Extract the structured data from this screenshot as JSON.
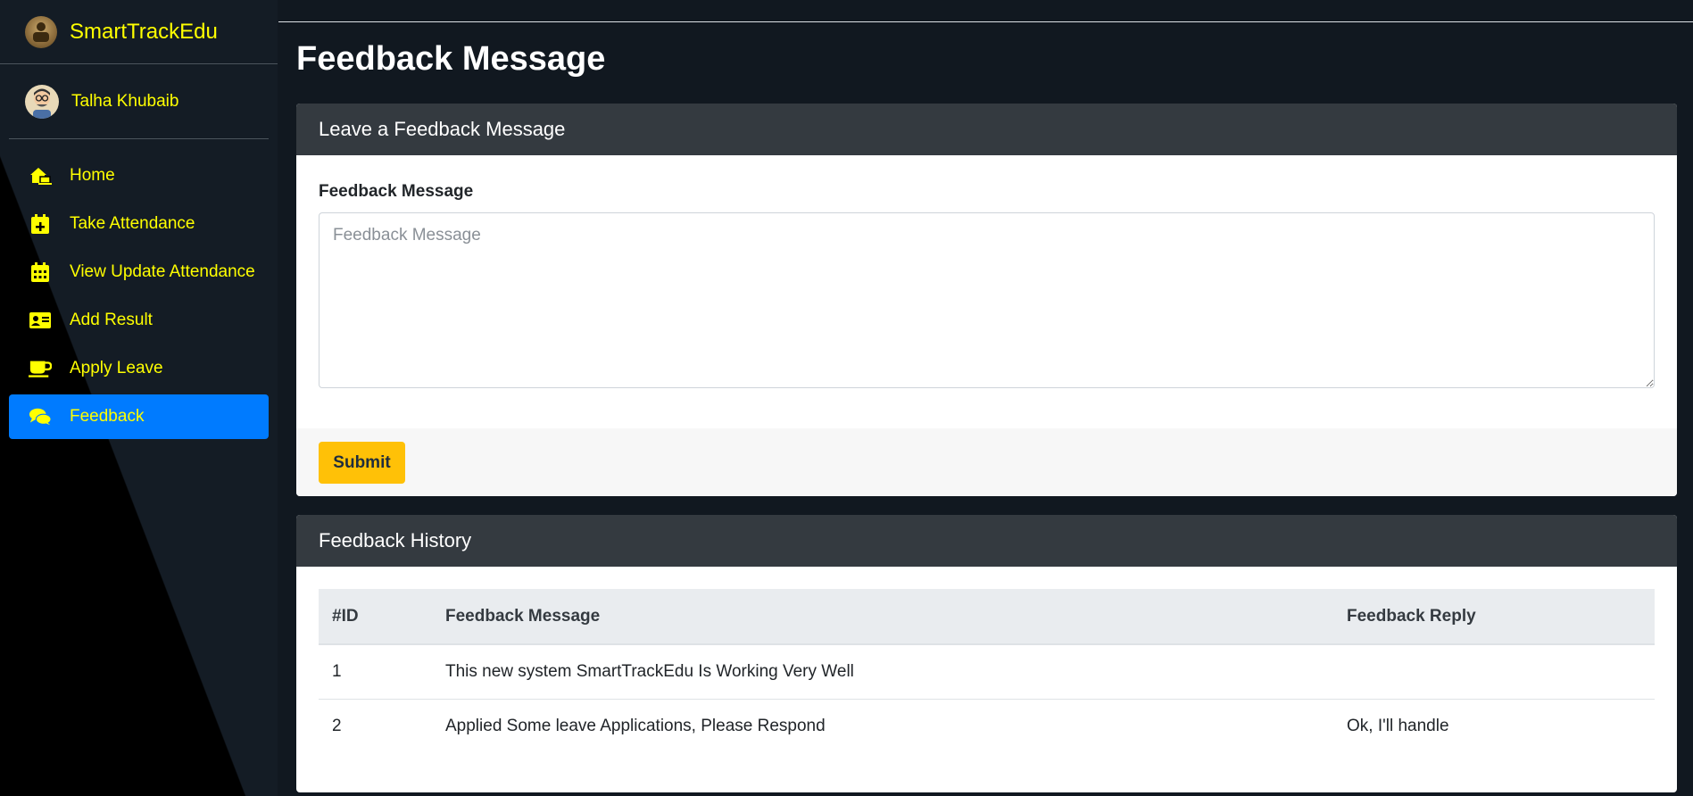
{
  "sidebar": {
    "brand": "SmartTrackEdu",
    "user_name": "Talha Khubaib",
    "items": [
      {
        "label": "Home",
        "icon": "home-laptop-icon",
        "active": false
      },
      {
        "label": "Take Attendance",
        "icon": "calendar-plus-icon",
        "active": false
      },
      {
        "label": "View Update Attendance",
        "icon": "calendar-grid-icon",
        "active": false
      },
      {
        "label": "Add Result",
        "icon": "id-card-icon",
        "active": false
      },
      {
        "label": "Apply Leave",
        "icon": "coffee-cup-icon",
        "active": false
      },
      {
        "label": "Feedback",
        "icon": "comments-icon",
        "active": true
      }
    ]
  },
  "page": {
    "title": "Feedback Message"
  },
  "form_card": {
    "header": "Leave a Feedback Message",
    "field_label": "Feedback Message",
    "field_placeholder": "Feedback Message",
    "field_value": "",
    "submit_label": "Submit"
  },
  "history_card": {
    "header": "Feedback History",
    "columns": [
      "#ID",
      "Feedback Message",
      "Feedback Reply"
    ],
    "rows": [
      [
        "1",
        "This new system SmartTrackEdu Is Working Very Well",
        ""
      ],
      [
        "2",
        "Applied Some leave Applications, Please Respond",
        "Ok, I'll handle"
      ]
    ]
  },
  "colors": {
    "accent_text": "#ffff00",
    "active_bg": "#007bff",
    "submit_bg": "#ffc107",
    "card_header_bg": "#343a40"
  }
}
